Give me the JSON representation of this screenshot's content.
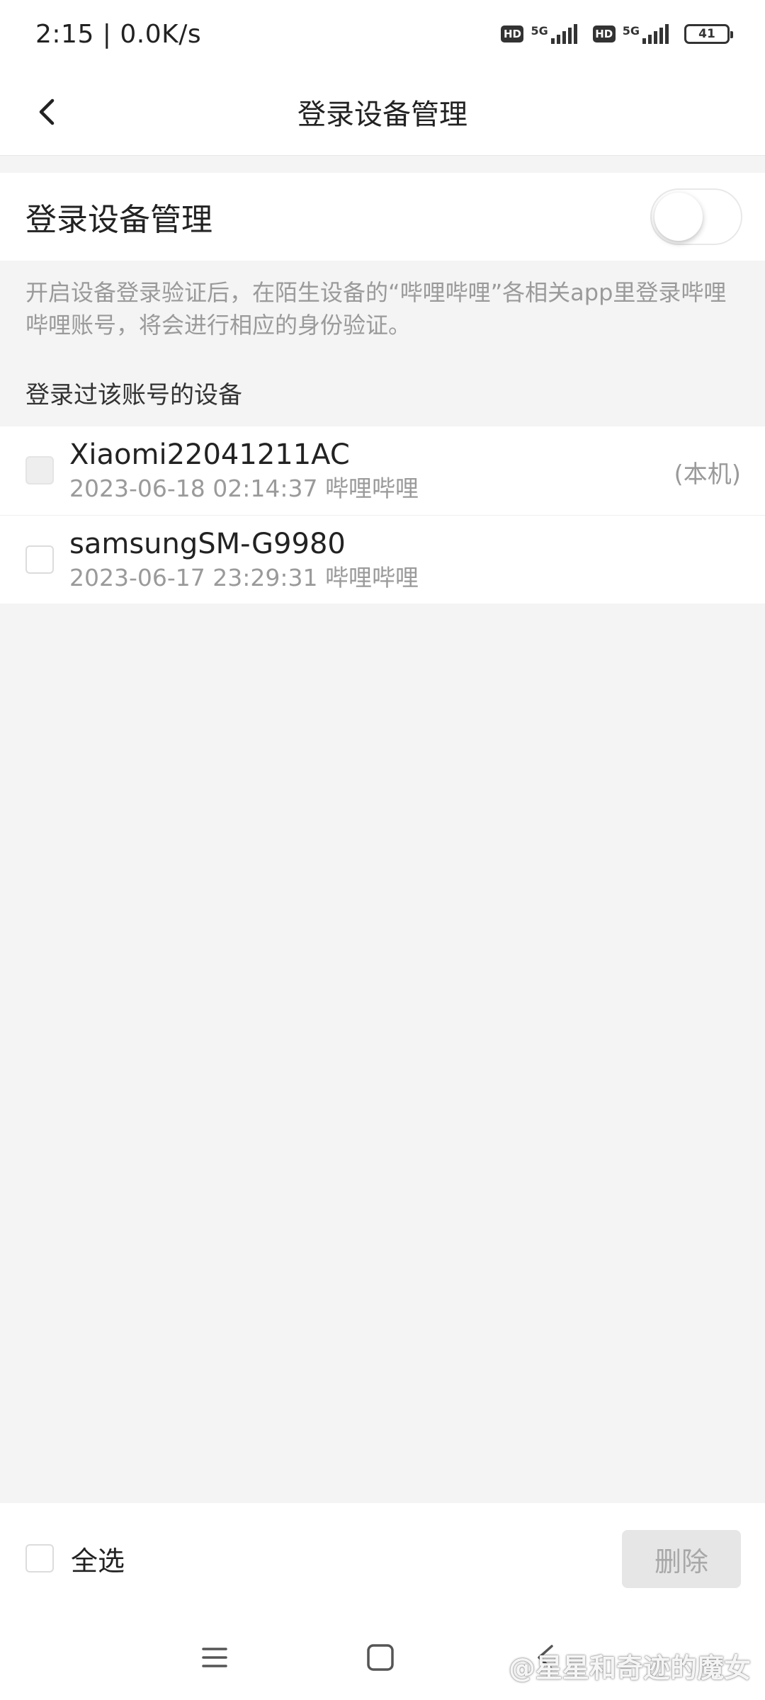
{
  "status_bar": {
    "time_speed": "2:15 | 0.0K/s",
    "sim1": {
      "hd": "HD",
      "network": "5G"
    },
    "sim2": {
      "hd": "HD",
      "network": "5G"
    },
    "battery": "41"
  },
  "header": {
    "title": "登录设备管理"
  },
  "login_protection": {
    "label": "登录设备管理",
    "enabled": false
  },
  "description": "开启设备登录验证后，在陌生设备的“哔哩哔哩”各相关app里登录哔哩哔哩账号，将会进行相应的身份验证。",
  "devices_section": {
    "title": "登录过该账号的设备",
    "devices": [
      {
        "name": "Xiaomi22041211AC",
        "meta": "2023-06-18 02:14:37 哔哩哔哩",
        "tag": "(本机)",
        "checkbox_disabled": true
      },
      {
        "name": "samsungSM-G9980",
        "meta": "2023-06-17 23:29:31 哔哩哔哩",
        "tag": "",
        "checkbox_disabled": false
      }
    ]
  },
  "bottom_bar": {
    "select_all_label": "全选",
    "delete_label": "删除"
  },
  "watermark": "@星星和奇迹的魔女",
  "colors": {
    "background": "#f4f4f4",
    "surface": "#ffffff",
    "text_primary": "#222222",
    "text_secondary": "#9a9a9a",
    "button_disabled_bg": "#e6e6e6"
  },
  "icons": {
    "back": "chevron-left-icon",
    "nav_menu": "menu-icon",
    "nav_home": "square-icon",
    "nav_back": "back-arrow-icon"
  }
}
